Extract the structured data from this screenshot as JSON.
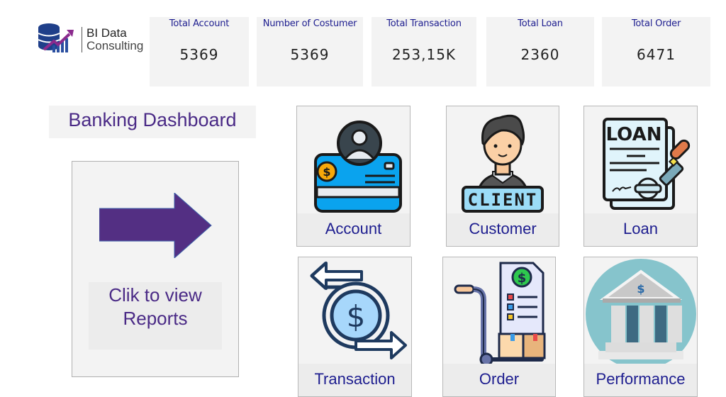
{
  "logo": {
    "line1": "BI Data",
    "line2": "Consulting",
    "icon": "database-growth-logo-icon"
  },
  "kpis": [
    {
      "title": "Total Account",
      "value": "5369"
    },
    {
      "title": "Number of Costumer",
      "value": "5369"
    },
    {
      "title": "Total Transaction",
      "value": "253,15K"
    },
    {
      "title": "Total Loan",
      "value": "2360"
    },
    {
      "title": "Total Order",
      "value": "6471"
    }
  ],
  "page_title": "Banking Dashboard",
  "report_button": {
    "line1": "Clik to view",
    "line2": "Reports",
    "icon": "arrow-right-icon"
  },
  "nav_tiles": [
    {
      "label": "Account",
      "icon": "bank-card-user-icon"
    },
    {
      "label": "Customer",
      "icon": "client-person-icon"
    },
    {
      "label": "Loan",
      "icon": "loan-document-stamp-icon"
    },
    {
      "label": "Transaction",
      "icon": "money-exchange-icon"
    },
    {
      "label": "Order",
      "icon": "order-trolley-icon"
    },
    {
      "label": "Performance",
      "icon": "bank-building-icon"
    }
  ],
  "colors": {
    "accent_purple": "#532f83",
    "label_blue": "#1d1d8f",
    "card_bg": "#f3f3f3"
  }
}
